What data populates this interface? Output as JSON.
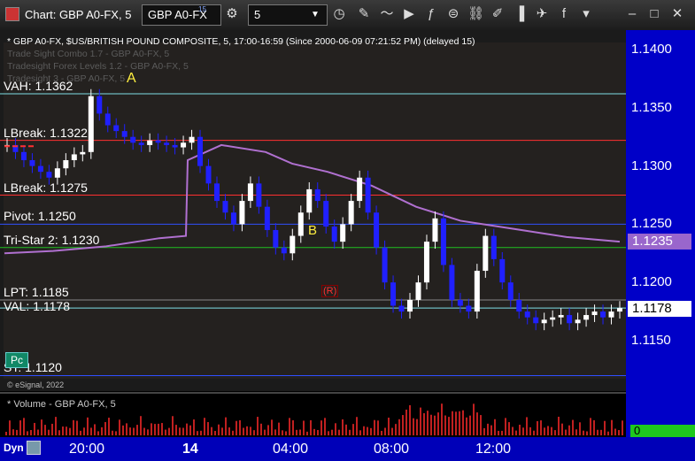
{
  "window": {
    "title": "Chart: GBP A0-FX, 5"
  },
  "toolbar": {
    "symbol": "GBP A0-FX",
    "symbol_sup": "15",
    "interval": "5"
  },
  "chart": {
    "header": "* GBP A0-FX, $US/BRITISH POUND COMPOSITE, 5, 17:00-16:59 (Since 2000-06-09 07:21:52 PM) (delayed 15)",
    "ghost_lines": [
      "Trade Sight Combo 1.7 - GBP A0-FX, 5",
      "Tradesight Forex Levels 1.2 - GBP A0-FX, 5",
      "Tradesight 3 - GBP A0-FX, 5"
    ],
    "copyright": "© eSignal, 2022",
    "pc_button": "Pc",
    "labels": {
      "A": "A",
      "B": "B",
      "R": "(R)"
    }
  },
  "levels": [
    {
      "label": "VAH: 1.1362",
      "price": 1.1362,
      "color": "#7ee0e6"
    },
    {
      "label": "LBreak: 1.1322",
      "price": 1.1322,
      "color": "#ff3030"
    },
    {
      "label": "LBreak: 1.1275",
      "price": 1.1275,
      "color": "#ff3030"
    },
    {
      "label": "Pivot: 1.1250",
      "price": 1.125,
      "color": "#3050ff"
    },
    {
      "label": "Tri-Star 2: 1.1230",
      "price": 1.123,
      "color": "#20c020"
    },
    {
      "label": "LPT: 1.1185",
      "price": 1.1185,
      "color": "#888888"
    },
    {
      "label": "VAL: 1.1178",
      "price": 1.1178,
      "color": "#7ee0e6"
    },
    {
      "label": "ST: 1.1120",
      "price": 1.112,
      "color": "#3050ff"
    }
  ],
  "yaxis": {
    "ticks": [
      "1.1400",
      "1.1350",
      "1.1300",
      "1.1250",
      "1.1200",
      "1.1150"
    ],
    "tick_values": [
      1.14,
      1.135,
      1.13,
      1.125,
      1.12,
      1.115
    ],
    "tag_vwap": "1.1235",
    "tag_last": "1.1178"
  },
  "volume": {
    "label": "* Volume - GBP A0-FX, 5",
    "tag": "0"
  },
  "xaxis": {
    "ticks": [
      "20:00",
      "14",
      "04:00",
      "08:00",
      "12:00"
    ],
    "dyn": "Dyn"
  },
  "colors": {
    "axis": "#0000c8",
    "candle_up": "#ffffff",
    "candle_down": "#2020ff",
    "vwap": "#b070d0"
  },
  "chart_data": {
    "type": "candlestick",
    "title": "",
    "vwap_last": 1.1235,
    "last": 1.1178,
    "closes_approx": [
      1.1318,
      1.1312,
      1.1305,
      1.13,
      1.1295,
      1.129,
      1.1298,
      1.1305,
      1.131,
      1.1312,
      1.136,
      1.1345,
      1.1335,
      1.133,
      1.1325,
      1.132,
      1.1318,
      1.1322,
      1.132,
      1.1318,
      1.1316,
      1.132,
      1.1325,
      1.13,
      1.1285,
      1.127,
      1.126,
      1.125,
      1.127,
      1.1285,
      1.1265,
      1.1245,
      1.123,
      1.1225,
      1.124,
      1.126,
      1.128,
      1.127,
      1.1248,
      1.1235,
      1.125,
      1.127,
      1.129,
      1.126,
      1.123,
      1.12,
      1.118,
      1.1175,
      1.1185,
      1.12,
      1.1235,
      1.1255,
      1.1215,
      1.1185,
      1.118,
      1.1175,
      1.121,
      1.124,
      1.122,
      1.12,
      1.1185,
      1.1175,
      1.117,
      1.1165,
      1.1168,
      1.117,
      1.1172,
      1.1165,
      1.1168,
      1.1172,
      1.1175,
      1.117,
      1.1175,
      1.1178
    ]
  }
}
